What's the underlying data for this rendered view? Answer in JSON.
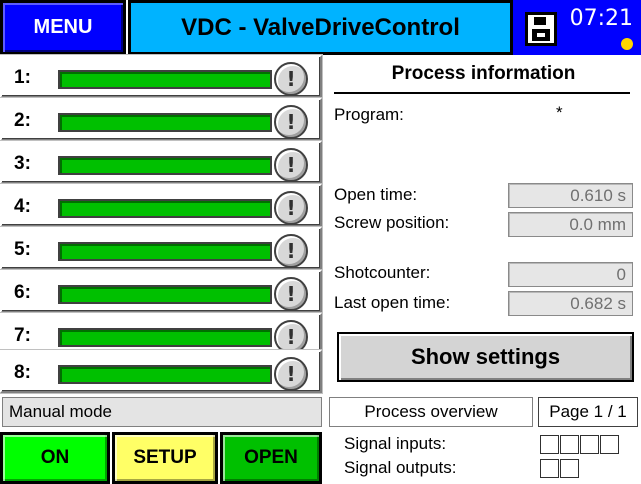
{
  "header": {
    "menu_label": "MENU",
    "title": "VDC - ValveDriveControl",
    "time": "07:21",
    "save_icon": "floppy-disk-icon",
    "alarm_color": "#ffd700"
  },
  "valves": [
    {
      "label": "1:",
      "icon": "info-icon",
      "symbol": "!"
    },
    {
      "label": "2:",
      "icon": "info-icon",
      "symbol": "!"
    },
    {
      "label": "3:",
      "icon": "info-icon",
      "symbol": "!"
    },
    {
      "label": "4:",
      "icon": "info-icon",
      "symbol": "!"
    },
    {
      "label": "5:",
      "icon": "info-icon",
      "symbol": "!"
    },
    {
      "label": "6:",
      "icon": "info-icon",
      "symbol": "!"
    },
    {
      "label": "7:",
      "icon": "info-icon",
      "symbol": "!"
    },
    {
      "label": "8:",
      "icon": "info-icon",
      "symbol": "!"
    }
  ],
  "process_info": {
    "title": "Process information",
    "program_label": "Program:",
    "program_value": "*",
    "open_time_label": "Open time:",
    "open_time_value": "0.610 s",
    "screw_position_label": "Screw position:",
    "screw_position_value": "0.0  mm",
    "shotcounter_label": "Shotcounter:",
    "shotcounter_value": "0",
    "last_open_time_label": "Last open time:",
    "last_open_time_value": "0.682 s",
    "show_settings_label": "Show settings"
  },
  "status": {
    "mode": "Manual mode",
    "view": "Process overview",
    "page": "Page 1 / 1"
  },
  "controls": {
    "on_label": "ON",
    "setup_label": "SETUP",
    "open_label": "OPEN"
  },
  "signals": {
    "inputs_label": "Signal inputs:",
    "outputs_label": "Signal outputs:",
    "inputs_count": 4,
    "outputs_count": 2
  },
  "colors": {
    "menu_blue": "#0000ff",
    "title_cyan": "#00b3ff",
    "valve_green": "#00c000",
    "on_green": "#00ff00",
    "setup_yellow": "#ffff66"
  }
}
